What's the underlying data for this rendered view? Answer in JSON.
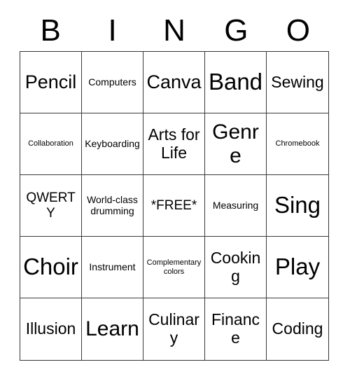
{
  "card": {
    "header_letters": [
      "B",
      "I",
      "N",
      "G",
      "O"
    ],
    "rows": [
      [
        {
          "text": "Pencil",
          "size": "lg"
        },
        {
          "text": "Computers",
          "size": "xs"
        },
        {
          "text": "Canva",
          "size": "lg"
        },
        {
          "text": "Band",
          "size": "xxl"
        },
        {
          "text": "Sewing",
          "size": "md"
        }
      ],
      [
        {
          "text": "Collaboration",
          "size": "xxs"
        },
        {
          "text": "Keyboarding",
          "size": "xs"
        },
        {
          "text": "Arts for Life",
          "size": "md"
        },
        {
          "text": "Genre",
          "size": "xl"
        },
        {
          "text": "Chromebook",
          "size": "xxs"
        }
      ],
      [
        {
          "text": "QWERTY",
          "size": "sm"
        },
        {
          "text": "World-class drumming",
          "size": "xs"
        },
        {
          "text": "*FREE*",
          "size": "sm"
        },
        {
          "text": "Measuring",
          "size": "xs"
        },
        {
          "text": "Sing",
          "size": "xxl"
        }
      ],
      [
        {
          "text": "Choir",
          "size": "xxl"
        },
        {
          "text": "Instrument",
          "size": "xs"
        },
        {
          "text": "Complementary colors",
          "size": "xxs"
        },
        {
          "text": "Cooking",
          "size": "md"
        },
        {
          "text": "Play",
          "size": "xxl"
        }
      ],
      [
        {
          "text": "Illusion",
          "size": "md"
        },
        {
          "text": "Learn",
          "size": "xl"
        },
        {
          "text": "Culinary",
          "size": "md"
        },
        {
          "text": "Finance",
          "size": "md"
        },
        {
          "text": "Coding",
          "size": "md"
        }
      ]
    ],
    "colors": {
      "background": "#ffffff",
      "text": "#000000",
      "grid_line": "#3a3a3a",
      "grid_border": "#333333"
    }
  }
}
